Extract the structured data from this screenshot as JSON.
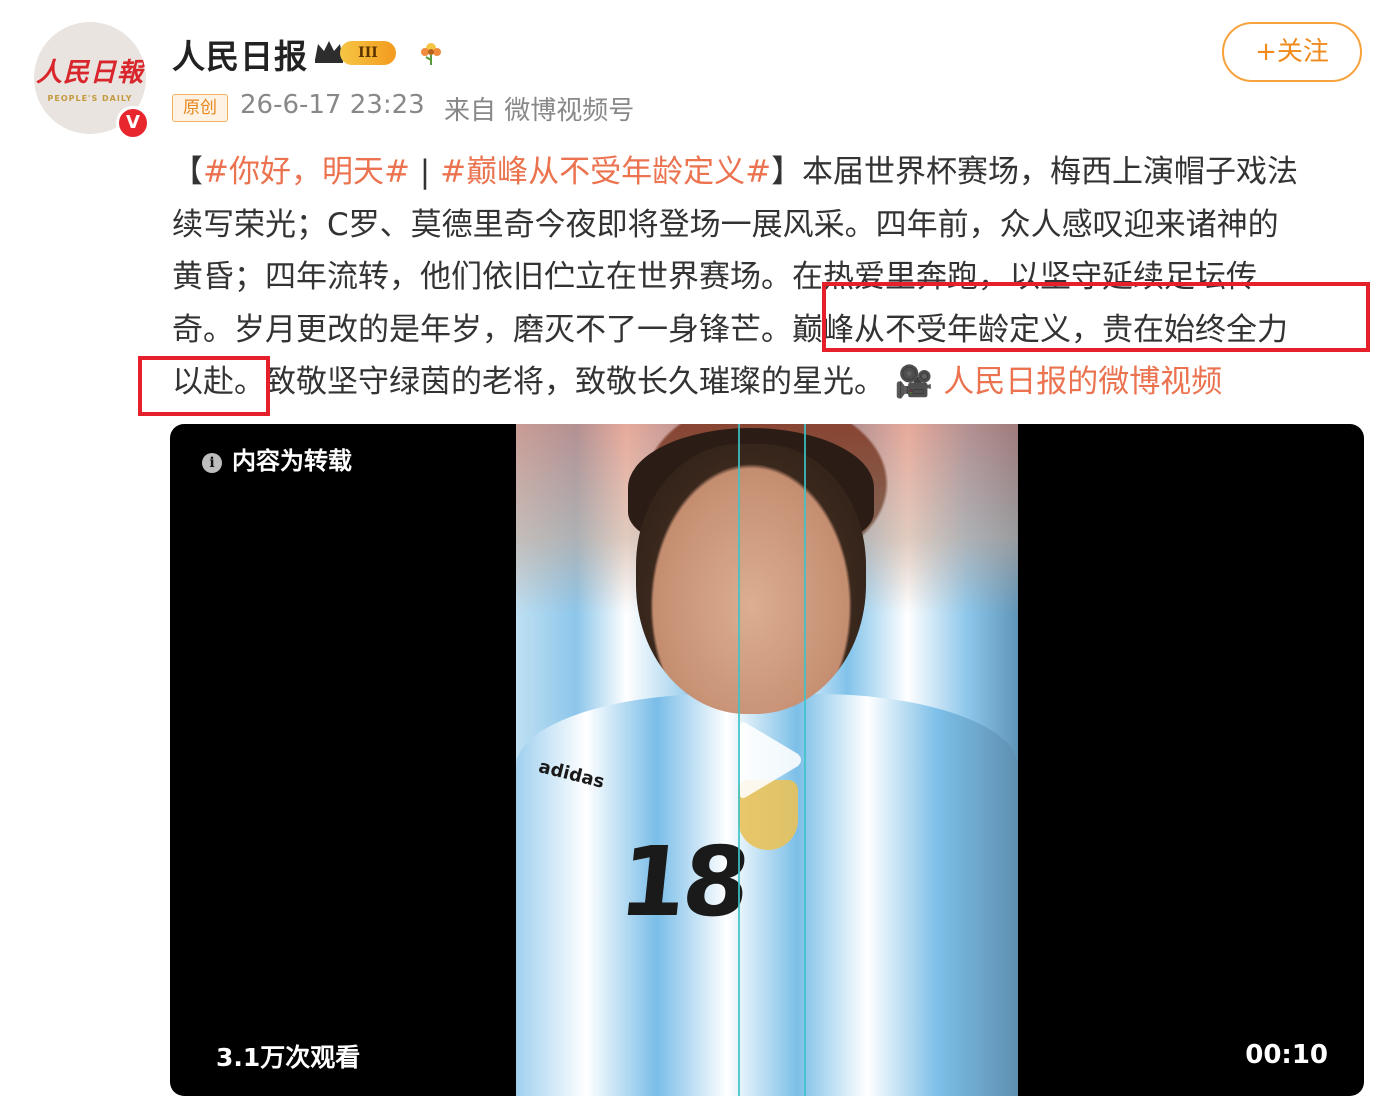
{
  "account": {
    "avatar_logo": "人民日報",
    "avatar_sub": "PEOPLE'S DAILY",
    "verified_mark": "V",
    "name": "人民日报",
    "level": "III"
  },
  "follow_button": {
    "label": "+关注"
  },
  "meta": {
    "original_tag": "原创",
    "time": "26-6-17 23:23",
    "source": "来自 微博视频号"
  },
  "post": {
    "lines": [
      [
        {
          "t": "【",
          "k": "text"
        },
        {
          "t": "#你好，明天#",
          "k": "topic"
        },
        {
          "t": " | ",
          "k": "text"
        },
        {
          "t": "#巅峰从不受年龄定义#",
          "k": "topic"
        },
        {
          "t": "】本届世界杯赛场，梅西上演帽子戏法",
          "k": "text"
        }
      ],
      [
        {
          "t": "续写荣光；C罗、莫德里奇今夜即将登场一展风采。四年前，众人感叹迎来诸神的",
          "k": "text"
        }
      ],
      [
        {
          "t": "黄昏；四年流转，他们依旧伫立在世界赛场。在热爱里奔跑，以坚守延续足坛传",
          "k": "text"
        }
      ],
      [
        {
          "t": "奇。岁月更改的是年岁，磨灭不了一身锋芒。巅峰从不受年龄定义，贵在始终全力",
          "k": "text"
        }
      ],
      [
        {
          "t": "以赴。致敬坚守绿茵的老将，致敬长久璀璨的星光。 ",
          "k": "text"
        },
        {
          "t": "🎥 人民日报的微博视频",
          "k": "link"
        }
      ]
    ]
  },
  "video": {
    "reprint_label": "内容为转载",
    "info_icon": "i",
    "jersey_brand": "adidas",
    "jersey_number": "18",
    "view_count": "3.1万次观看",
    "duration": "00:10"
  },
  "colors": {
    "topic": "#eb7350",
    "follow_orange": "#f08a1c",
    "highlight_red": "#e5202a"
  }
}
